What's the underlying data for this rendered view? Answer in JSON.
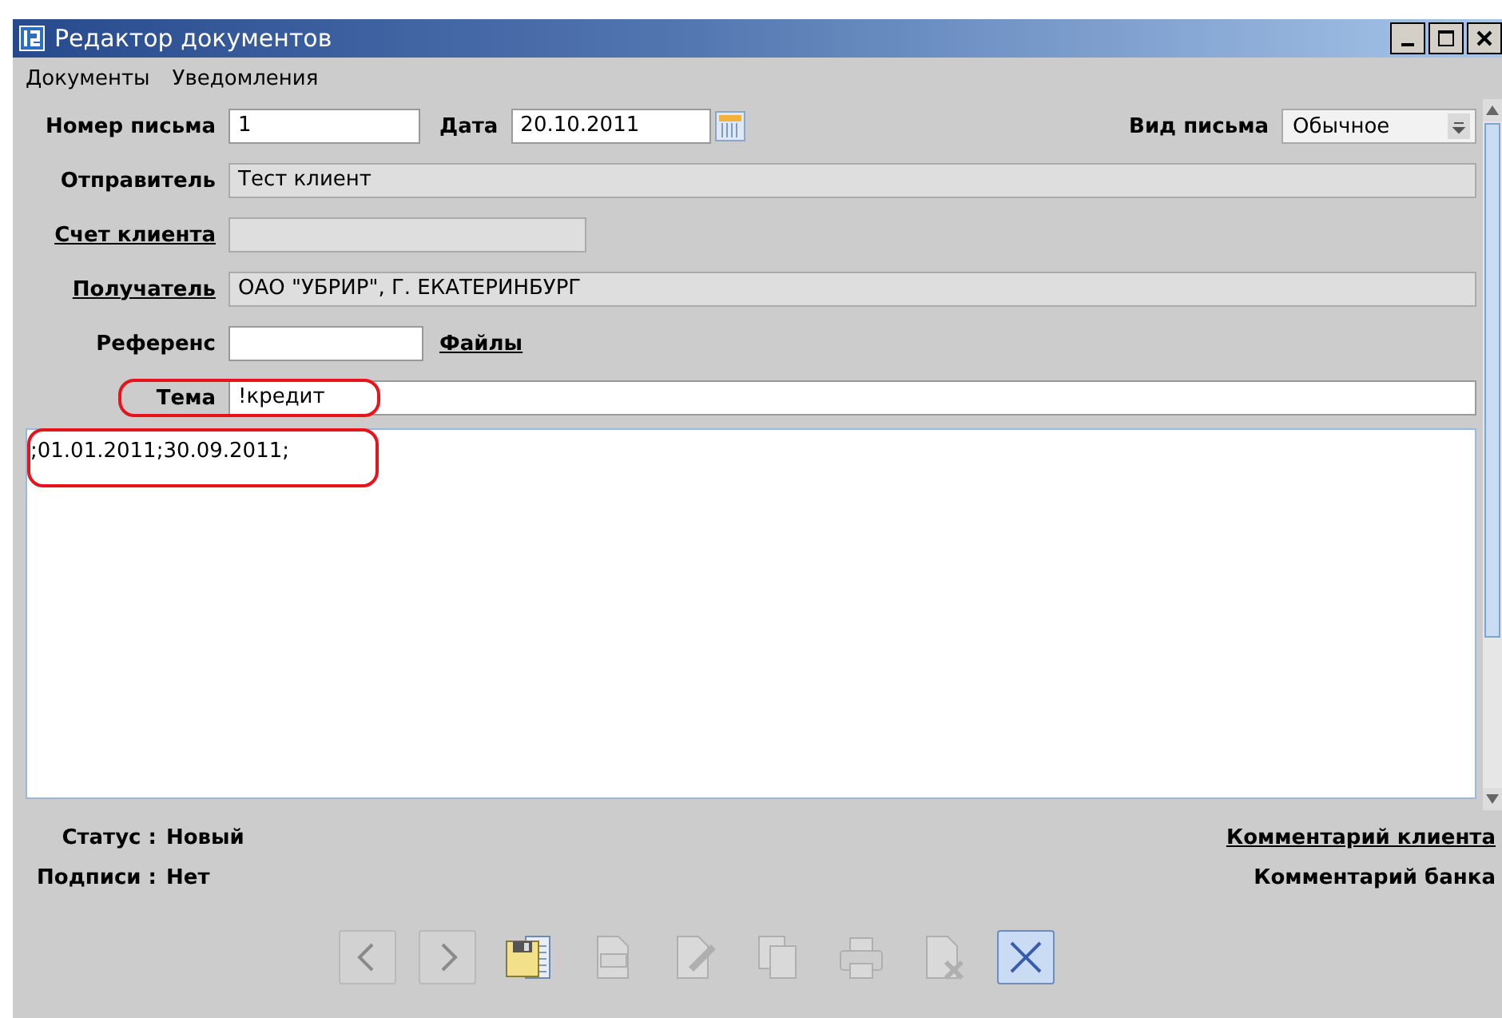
{
  "window": {
    "title": "Редактор документов"
  },
  "menu": [
    "Документы",
    "Уведомления"
  ],
  "header": {
    "number_label": "Номер письма",
    "number": "1",
    "date_label": "Дата",
    "date": "20.10.2011",
    "type_label": "Вид письма",
    "type": "Обычное"
  },
  "fields": [
    {
      "label": "Отправитель",
      "value": "Тест клиент",
      "link": false,
      "readonly": true,
      "kind": "wide",
      "highlighted": false
    },
    {
      "label": "Счет клиента",
      "link": true,
      "readonly": true,
      "kind": "short",
      "highlighted": false
    },
    {
      "label": "Получатель",
      "value": "ОАО \"УБРИР\", Г. ЕКАТЕРИНБУРГ",
      "link": true,
      "readonly": true,
      "kind": "wide",
      "highlighted": false
    },
    {
      "label": "Референс",
      "link": false,
      "readonly": false,
      "kind": "files",
      "extra": "Файлы",
      "highlighted": false
    },
    {
      "label": "Тема",
      "value": "!кредит",
      "link": false,
      "readonly": false,
      "kind": "wide",
      "highlighted": true
    }
  ],
  "body": {
    "text": ";01.01.2011;30.09.2011;",
    "highlighted": true
  },
  "status": [
    {
      "label": "Статус :",
      "value": "Новый"
    },
    {
      "label": "Подписи :",
      "value": "Нет"
    }
  ],
  "comments": [
    {
      "text": "Комментарий клиента",
      "link": true
    },
    {
      "text": "Комментарий банка",
      "link": false
    }
  ],
  "toolbar": [
    {
      "kind": "prev",
      "disabled": true
    },
    {
      "kind": "next",
      "disabled": true
    },
    {
      "kind": "save",
      "disabled": false
    },
    {
      "kind": "text",
      "disabled": true
    },
    {
      "kind": "edit",
      "disabled": true
    },
    {
      "kind": "copy",
      "disabled": true
    },
    {
      "kind": "print",
      "disabled": true
    },
    {
      "kind": "delete",
      "disabled": true
    },
    {
      "kind": "close",
      "disabled": false
    }
  ]
}
